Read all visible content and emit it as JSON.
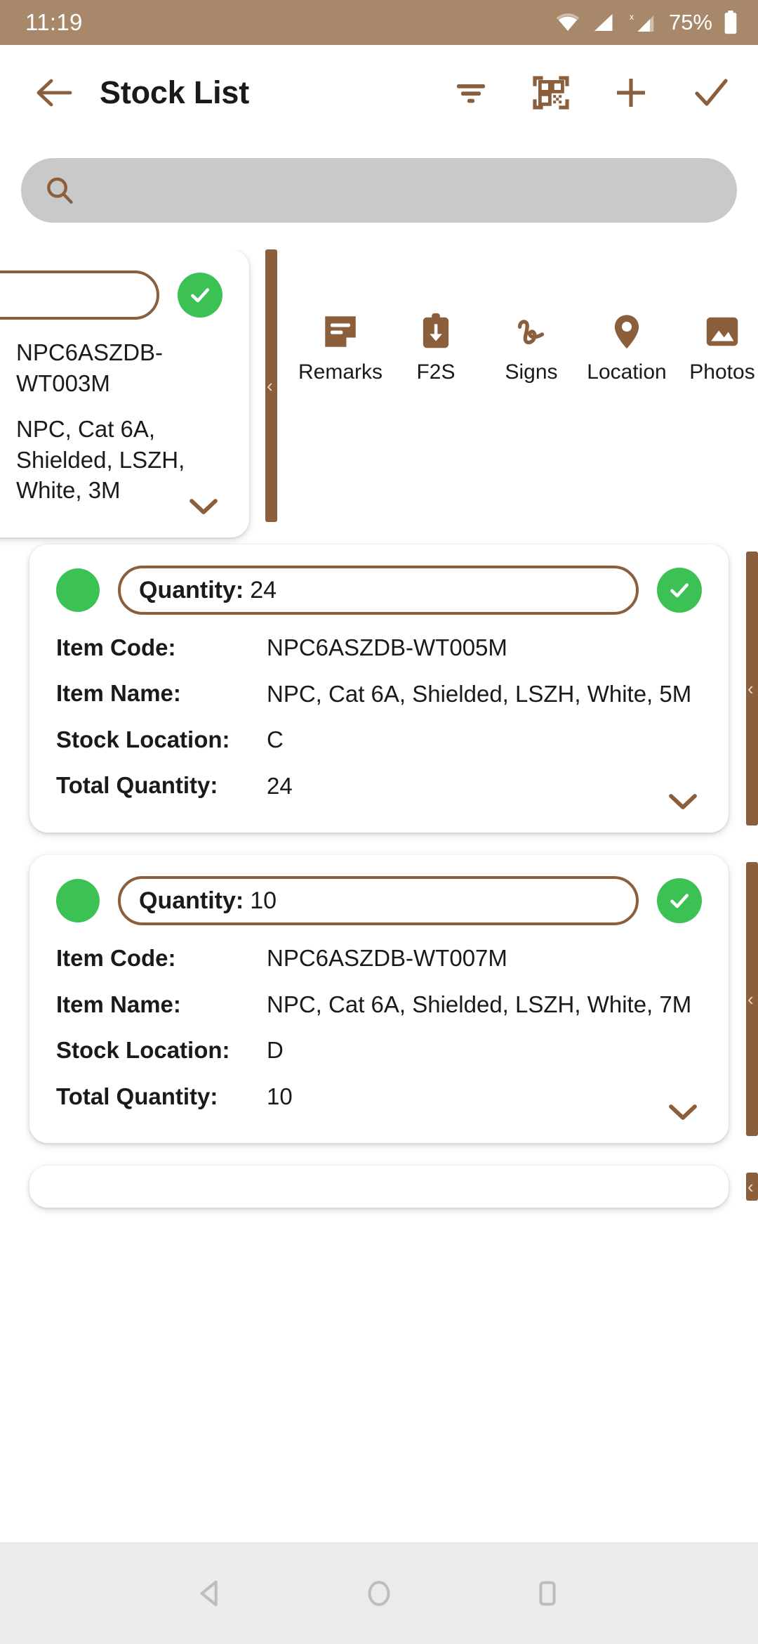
{
  "status_bar": {
    "time": "11:19",
    "battery_percent": "75%",
    "icons": [
      "wifi-icon",
      "signal-icon",
      "signal-x-icon",
      "battery-icon"
    ],
    "background_color": "#a8886a",
    "text_color": "#ffffff"
  },
  "app_bar": {
    "title": "Stock List",
    "back_icon": "arrow-left-icon",
    "actions": [
      {
        "name": "filter-icon",
        "label": "Filter"
      },
      {
        "name": "qr-scan-icon",
        "label": "Scan"
      },
      {
        "name": "plus-icon",
        "label": "Add"
      },
      {
        "name": "check-icon",
        "label": "Confirm"
      }
    ],
    "accent_color": "#8b5e3c"
  },
  "search": {
    "value": "",
    "placeholder": "",
    "icon": "search-icon",
    "background_color": "#c9c9c9"
  },
  "swipe_actions": [
    {
      "label": "Remarks",
      "icon": "note-remarks-icon"
    },
    {
      "label": "F2S",
      "icon": "clipboard-download-icon"
    },
    {
      "label": "Signs",
      "icon": "signature-icon"
    },
    {
      "label": "Location",
      "icon": "map-pin-icon"
    },
    {
      "label": "Photos",
      "icon": "image-icon"
    }
  ],
  "field_labels": {
    "quantity": "Quantity:",
    "item_code": "Item Code:",
    "item_name": "Item Name:",
    "stock_location": "Stock Location:",
    "total_quantity": "Total Quantity:"
  },
  "cards": [
    {
      "state": "swiped",
      "quantity": "",
      "item_code": "NPC6ASZDB-WT003M",
      "item_name": "NPC, Cat 6A, Shielded, LSZH, White, 3M",
      "item_code_visible": "WT003M",
      "item_name_visible": "Shielded, LSZH,",
      "stock_location": "",
      "total_quantity": "",
      "status": "verified"
    },
    {
      "state": "normal",
      "quantity": "24",
      "item_code": "NPC6ASZDB-WT005M",
      "item_name": "NPC, Cat 6A, Shielded, LSZH, White, 5M",
      "stock_location": "C",
      "total_quantity": "24",
      "status": "verified"
    },
    {
      "state": "normal",
      "quantity": "10",
      "item_code": "NPC6ASZDB-WT007M",
      "item_name": "NPC, Cat 6A, Shielded, LSZH, White, 7M",
      "stock_location": "D",
      "total_quantity": "10",
      "status": "verified"
    }
  ],
  "colors": {
    "brown": "#8b5e3c",
    "status_brown": "#a8886a",
    "green": "#3cc254",
    "card_white": "#ffffff",
    "search_grey": "#c9c9c9",
    "nav_grey": "#ebebeb"
  },
  "nav_bar": {
    "buttons": [
      {
        "name": "android-back-icon",
        "label": "Back"
      },
      {
        "name": "android-home-icon",
        "label": "Home"
      },
      {
        "name": "android-recents-icon",
        "label": "Recents"
      }
    ]
  }
}
